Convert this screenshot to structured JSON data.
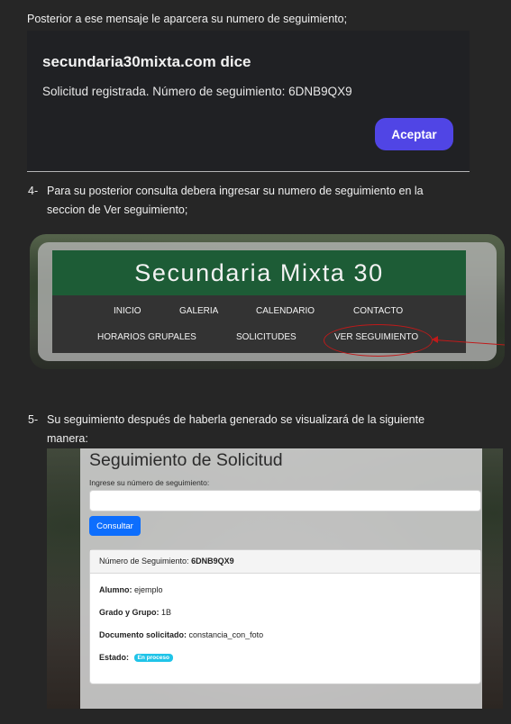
{
  "intro_text": "Posterior a ese mensaje le aparcera su numero de seguimiento;",
  "dialog": {
    "host": "secundaria30mixta.com dice",
    "message": "Solicitud registrada. Número de seguimiento: 6DNB9QX9",
    "ok_label": "Aceptar"
  },
  "step4": {
    "number": "4-",
    "line1": "Para su posterior consulta debera ingresar su numero de seguimiento en la",
    "line2": "seccion de Ver seguimiento;"
  },
  "site": {
    "title": "Secundaria Mixta 30",
    "menu_row1": [
      "INICIO",
      "GALERIA",
      "CALENDARIO",
      "CONTACTO"
    ],
    "menu_row2": [
      "HORARIOS GRUPALES",
      "SOLICITUDES",
      "VER SEGUIMIENTO"
    ]
  },
  "step5": {
    "number": "5-",
    "line1": "Su seguimiento después de haberla generado se visualizará de la siguiente",
    "line2": "manera:"
  },
  "tracking": {
    "heading": "Seguimiento de Solicitud",
    "input_label": "Ingrese su número de seguimiento:",
    "button": "Consultar",
    "card_header_label": "Número de Seguimiento:",
    "card_header_value": "6DNB9QX9",
    "alumno_label": "Alumno:",
    "alumno_value": "ejemplo",
    "grado_label": "Grado y Grupo:",
    "grado_value": "1B",
    "documento_label": "Documento solicitado:",
    "documento_value": "constancia_con_foto",
    "estado_label": "Estado:",
    "estado_value": "En proceso"
  }
}
